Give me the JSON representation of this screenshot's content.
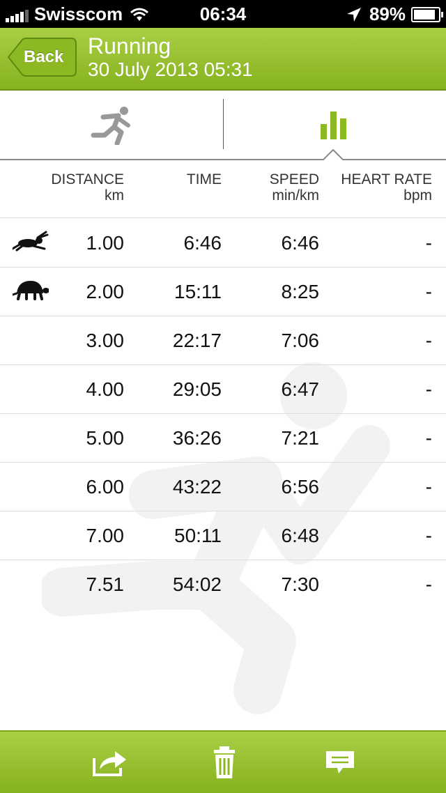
{
  "status_bar": {
    "carrier": "Swisscom",
    "time": "06:34",
    "battery": "89%"
  },
  "nav": {
    "back_label": "Back",
    "title": "Running",
    "subtitle": "30 July 2013 05:31"
  },
  "tabs": [
    {
      "icon": "runner-icon",
      "selected": false
    },
    {
      "icon": "bar-chart-icon",
      "selected": true
    }
  ],
  "table": {
    "headers": [
      {
        "label": "DISTANCE",
        "unit": "km"
      },
      {
        "label": "TIME",
        "unit": ""
      },
      {
        "label": "SPEED",
        "unit": "min/km"
      },
      {
        "label": "HEART RATE",
        "unit": "bpm"
      }
    ],
    "rows": [
      {
        "icon": "hare-icon",
        "distance": "1.00",
        "time": "6:46",
        "speed": "6:46",
        "heart_rate": "-"
      },
      {
        "icon": "tortoise-icon",
        "distance": "2.00",
        "time": "15:11",
        "speed": "8:25",
        "heart_rate": "-"
      },
      {
        "icon": "",
        "distance": "3.00",
        "time": "22:17",
        "speed": "7:06",
        "heart_rate": "-"
      },
      {
        "icon": "",
        "distance": "4.00",
        "time": "29:05",
        "speed": "6:47",
        "heart_rate": "-"
      },
      {
        "icon": "",
        "distance": "5.00",
        "time": "36:26",
        "speed": "7:21",
        "heart_rate": "-"
      },
      {
        "icon": "",
        "distance": "6.00",
        "time": "43:22",
        "speed": "6:56",
        "heart_rate": "-"
      },
      {
        "icon": "",
        "distance": "7.00",
        "time": "50:11",
        "speed": "6:48",
        "heart_rate": "-"
      },
      {
        "icon": "",
        "distance": "7.51",
        "time": "54:02",
        "speed": "7:30",
        "heart_rate": "-"
      }
    ]
  },
  "toolbar": {
    "buttons": [
      "share-icon",
      "trash-icon",
      "comment-icon"
    ]
  },
  "colors": {
    "accent_green": "#8dba25",
    "watermark_gray": "#f2f2f2"
  }
}
